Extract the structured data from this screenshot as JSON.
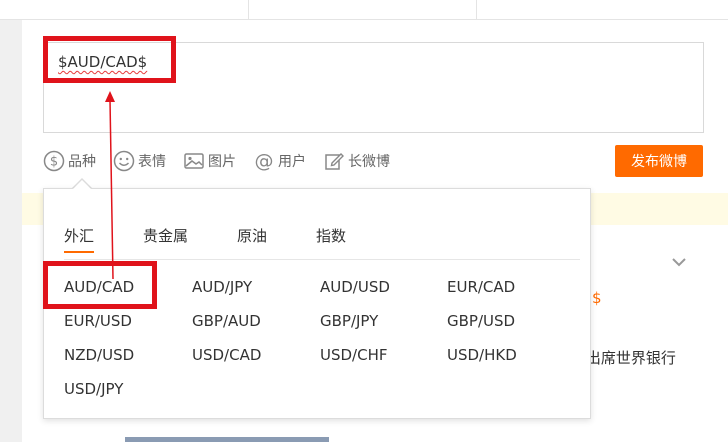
{
  "composer": {
    "text": "$AUD/CAD$"
  },
  "toolbar": {
    "variety": "品种",
    "emoji": "表情",
    "image": "图片",
    "user": "用户",
    "long_post": "长微博"
  },
  "publish_button": "发布微博",
  "dropdown": {
    "tabs": [
      {
        "label": "外汇",
        "active": true
      },
      {
        "label": "贵金属"
      },
      {
        "label": "原油"
      },
      {
        "label": "指数"
      }
    ],
    "pairs": [
      "AUD/CAD",
      "AUD/JPY",
      "AUD/USD",
      "EUR/CAD",
      "EUR/USD",
      "GBP/AUD",
      "GBP/JPY",
      "GBP/USD",
      "NZD/USD",
      "USD/CAD",
      "USD/CHF",
      "USD/HKD",
      "USD/JPY"
    ]
  },
  "background": {
    "dollar_sign": "$",
    "bank_fragment": "]出席世界银行"
  },
  "colors": {
    "accent": "#ff6a00",
    "highlight": "#e0131b"
  }
}
